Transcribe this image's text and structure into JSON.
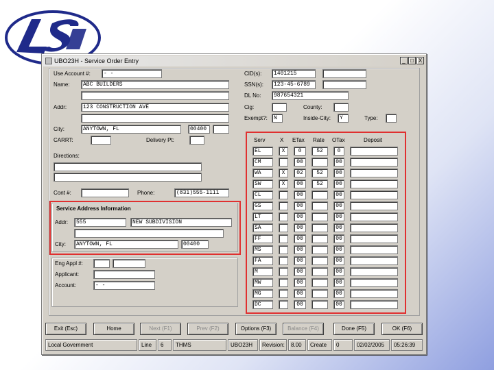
{
  "window": {
    "title": "UBO23H - Service Order Entry",
    "controls": {
      "minimize": "_",
      "maximize": "□",
      "close": "X"
    }
  },
  "left_form": {
    "use_account_label": "Use Account #:",
    "use_account_value": "-      -",
    "name_label": "Name:",
    "name_value": "ABC BUILDERS",
    "name_value2": "",
    "addr_label": "Addr:",
    "addr_value": "123 CONSTRUCTION AVE",
    "addr_value2": "",
    "city_label": "City:",
    "city_value": "ANYTOWN, FL",
    "zip_value": "00400",
    "zip_ext": "",
    "carrt_label": "CARRT:",
    "carrt_value": "",
    "delivery_label": "Delivery Pt:",
    "delivery_value": "",
    "directions_label": "Directions:",
    "directions_line1": "",
    "directions_line2": "",
    "contract_label": "Cont #:",
    "contract_value": "",
    "phone_label": "Phone:",
    "phone_value": "(831)555-1111"
  },
  "service_address": {
    "title": "Service Address Information",
    "addr_label": "Addr:",
    "addr_number": "555",
    "addr_street": "NEW SUBDIVISION",
    "addr_line2": "",
    "city_label": "City:",
    "city_value": "ANYTOWN, FL",
    "zip_value": "00400"
  },
  "eng_section": {
    "eng_appl_label": "Eng Appl #:",
    "eng_appl_a": "",
    "eng_appl_b": "",
    "applicant_label": "Applicant:",
    "applicant_value": "",
    "account_label": "Account:",
    "account_value": "-      -"
  },
  "right_form": {
    "cid_label": "CID(s):",
    "cid_value": "1401215",
    "cid_value2": "",
    "ssn_label": "SSN(s):",
    "ssn_value": "123-45-6789",
    "ssn_value2": "",
    "dl_label": "DL No:",
    "dl_value": "987654321",
    "cig_label": "Cig:",
    "cig_value": "",
    "county_label": "County:",
    "county_value": "",
    "exempt_label": "Exempt?:",
    "exempt_value": "N",
    "inside_city_label": "Inside-City:",
    "inside_city_value": "Y",
    "type_label": "Type:",
    "type_value": ""
  },
  "services_table": {
    "headers": [
      "Serv",
      "X",
      "ETax",
      "Rate",
      "OTax",
      "Deposit"
    ],
    "rows": [
      {
        "serv": "EL",
        "x": "X",
        "etax": "0",
        "rate": "52",
        "otax": "0",
        "deposit": ""
      },
      {
        "serv": "CM",
        "x": "",
        "etax": "00",
        "rate": "",
        "otax": "00",
        "deposit": ""
      },
      {
        "serv": "WA",
        "x": "X",
        "etax": "02",
        "rate": "52",
        "otax": "00",
        "deposit": ""
      },
      {
        "serv": "SW",
        "x": "X",
        "etax": "00",
        "rate": "52",
        "otax": "00",
        "deposit": ""
      },
      {
        "serv": "CL",
        "x": "",
        "etax": "00",
        "rate": "",
        "otax": "00",
        "deposit": ""
      },
      {
        "serv": "GS",
        "x": "",
        "etax": "00",
        "rate": "",
        "otax": "00",
        "deposit": ""
      },
      {
        "serv": "LT",
        "x": "",
        "etax": "00",
        "rate": "",
        "otax": "00",
        "deposit": ""
      },
      {
        "serv": "SA",
        "x": "",
        "etax": "00",
        "rate": "",
        "otax": "00",
        "deposit": ""
      },
      {
        "serv": "FF",
        "x": "",
        "etax": "00",
        "rate": "",
        "otax": "00",
        "deposit": ""
      },
      {
        "serv": "MS",
        "x": "",
        "etax": "00",
        "rate": "",
        "otax": "00",
        "deposit": ""
      },
      {
        "serv": "FA",
        "x": "",
        "etax": "00",
        "rate": "",
        "otax": "00",
        "deposit": ""
      },
      {
        "serv": "M",
        "x": "",
        "etax": "00",
        "rate": "",
        "otax": "00",
        "deposit": ""
      },
      {
        "serv": "MW",
        "x": "",
        "etax": "00",
        "rate": "",
        "otax": "00",
        "deposit": ""
      },
      {
        "serv": "MG",
        "x": "",
        "etax": "00",
        "rate": "",
        "otax": "00",
        "deposit": ""
      },
      {
        "serv": "DC",
        "x": "",
        "etax": "00",
        "rate": "",
        "otax": "00",
        "deposit": ""
      }
    ]
  },
  "buttons": {
    "exit": "Exit (Esc)",
    "home": "Home",
    "next": "Next (F1)",
    "prev": "Prev (F2)",
    "options": "Options (F3)",
    "balance": "Balance (F4)",
    "done": "Done (F5)",
    "ok": "OK (F6)"
  },
  "status_bar": {
    "org": "Local Government",
    "line_label": "Line",
    "line_value": "6",
    "user": "THMS",
    "program": "UBO23H",
    "revision_label": "Revision:",
    "revision_value": "8.00",
    "create_label": "Create",
    "create_value": "0",
    "date": "02/02/2005",
    "time": "05:26:39"
  },
  "colors": {
    "highlight_box": "#e03030",
    "logo_navy": "#1f2a8a",
    "window_face": "#d4d0c8"
  }
}
